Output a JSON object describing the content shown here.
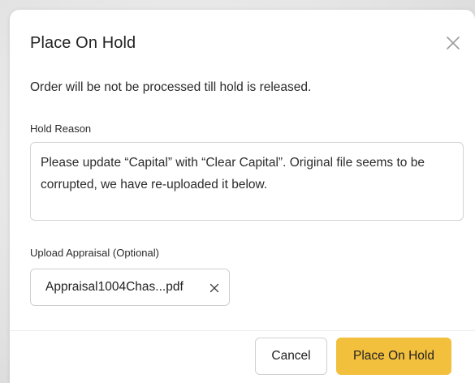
{
  "dialog": {
    "title": "Place On Hold",
    "subtitle": "Order will be not be processed till hold is released.",
    "hold_reason_label": "Hold Reason",
    "hold_reason_value": "Please update “Capital” with “Clear Capital”. Original file seems to be corrupted, we have re-uploaded it below.",
    "upload_label": "Upload Appraisal (Optional)",
    "uploaded_file": "Appraisal1004Chas...pdf",
    "cancel_label": "Cancel",
    "submit_label": "Place On Hold"
  },
  "colors": {
    "primary_button": "#f3c03e",
    "border": "#cfcfcf"
  },
  "icons": {
    "close": "close-icon",
    "remove_file": "remove-file-icon"
  }
}
